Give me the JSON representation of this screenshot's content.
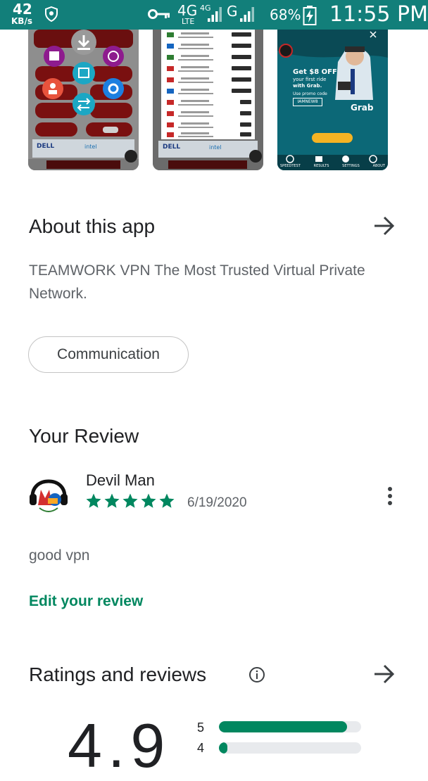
{
  "status_bar": {
    "net_speed_value": "42",
    "net_speed_unit": "KB/s",
    "network_type": "4G",
    "network_subtype": "LTE",
    "network_type_2": "4G",
    "network_type_3": "G",
    "battery_percent": "68%",
    "time": "11:55 PM",
    "icons": [
      "vpn-shield-icon",
      "key-icon",
      "signal-icon",
      "battery-charging-icon"
    ]
  },
  "screenshots": {
    "shot1": {
      "badge_1": "DELL",
      "badge_2": "intel"
    },
    "shot2": {
      "badge_1": "DELL",
      "badge_2": "intel"
    },
    "shot3": {
      "promo_title": "Get $8 OFF",
      "promo_line_1": "your first ride",
      "promo_line_2": "with Grab.",
      "promo_line_3": "Use promo code",
      "promo_code": "IAMNEW8",
      "promo_brand": "Grab",
      "nav_items": [
        "SPEEDTEST",
        "RESULTS",
        "SETTINGS",
        "ABOUT"
      ]
    }
  },
  "about": {
    "title": "About this app",
    "description": "TEAMWORK VPN The Most Trusted Virtual Private Network.",
    "category_chip": "Communication"
  },
  "your_review": {
    "title": "Your Review",
    "reviewer_name": "Devil Man",
    "stars": 5,
    "date": "6/19/2020",
    "text": "good vpn",
    "edit_link": "Edit your review"
  },
  "ratings": {
    "title": "Ratings and reviews",
    "average": "4.9",
    "bars": [
      {
        "label": "5",
        "fraction": 0.9
      },
      {
        "label": "4",
        "fraction": 0.06
      }
    ]
  },
  "colors": {
    "status_bar": "#127f7a",
    "accent_green": "#01875f",
    "bar_track": "#e8eaed",
    "secondary_text": "#5f6368"
  }
}
